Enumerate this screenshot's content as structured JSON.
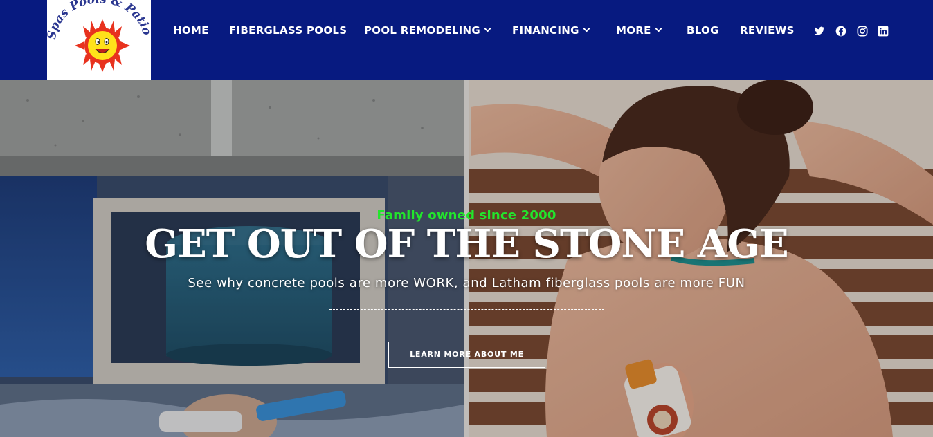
{
  "brand": {
    "logo_line1": "Spas Pools & Patio"
  },
  "nav": {
    "items": [
      {
        "label": "HOME",
        "dropdown": false
      },
      {
        "label": "FIBERGLASS POOLS",
        "dropdown": false
      },
      {
        "label": "POOL REMODELING",
        "dropdown": true
      },
      {
        "label": "FINANCING",
        "dropdown": true
      },
      {
        "label": "MORE",
        "dropdown": true
      },
      {
        "label": "BLOG",
        "dropdown": false
      },
      {
        "label": "REVIEWS",
        "dropdown": false
      }
    ],
    "social": [
      "twitter-icon",
      "facebook-icon",
      "instagram-icon",
      "linkedin-icon"
    ]
  },
  "hero": {
    "tagline": "Family owned since 2000",
    "headline": "GET OUT OF THE STONE AGE",
    "subline": "See why concrete pools are more WORK, and Latham fiberglass pools are more FUN",
    "cta_label": "LEARN MORE ABOUT ME"
  },
  "colors": {
    "header_bg": "#071a80",
    "tagline": "#22e62c",
    "text": "#ffffff"
  }
}
